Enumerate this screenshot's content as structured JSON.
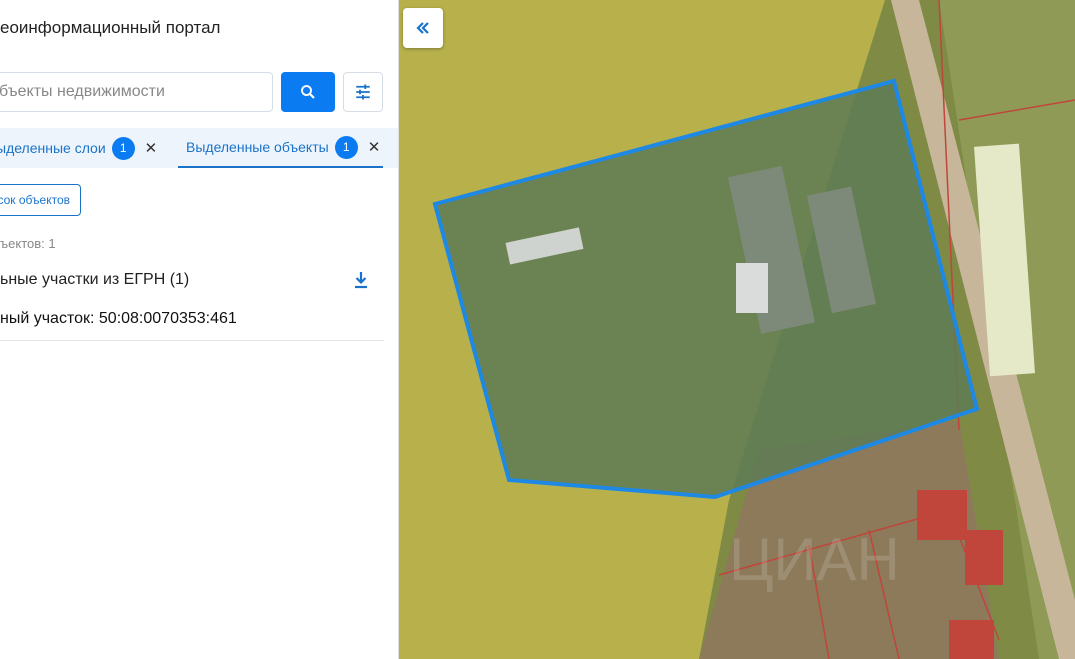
{
  "header": {
    "title": "еоинформационный портал"
  },
  "search": {
    "placeholder": "бъекты недвижимости"
  },
  "tabs": [
    {
      "label": "ыделенные слои",
      "count": "1"
    },
    {
      "label": "Выделенные объекты",
      "count": "1"
    }
  ],
  "results": {
    "list_button": "сок объектов",
    "count_label": "ъектов: 1",
    "group_title": "ьные участки из ЕГРН (1)",
    "item": "ный участок: 50:08:0070353:461"
  },
  "map": {
    "parcel_color": "#1e88e5",
    "watermark": "ЦИАН"
  },
  "icons": {
    "search": "search-icon",
    "filter": "tune-icon",
    "close": "close-icon",
    "download": "download-icon",
    "collapse": "chevrons-left-icon"
  }
}
